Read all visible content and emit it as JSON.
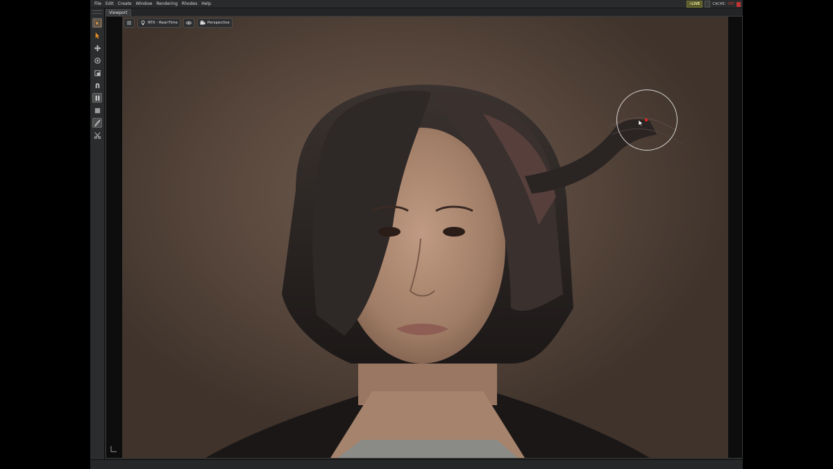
{
  "menubar": {
    "items": [
      "File",
      "Edit",
      "Create",
      "Window",
      "Rendering",
      "Rhodes",
      "Help"
    ],
    "live_label": "LIVE",
    "cache_label": "CACHE:",
    "cache_value": "OFF"
  },
  "tabs": {
    "viewport": "Viewport"
  },
  "viewport": {
    "render_mode": "RTX - Real-Time",
    "camera": "Perspective"
  },
  "toolbar": {
    "tools": [
      "select-icon",
      "move-icon",
      "rotate-icon",
      "scale-icon",
      "snap-icon",
      "pause-icon",
      "stop-icon",
      "brush-icon",
      "scissors-icon"
    ]
  },
  "colors": {
    "accent": "#e8e8a0",
    "cache_off": "#d03a3a",
    "cursor_dot": "#e22222"
  }
}
